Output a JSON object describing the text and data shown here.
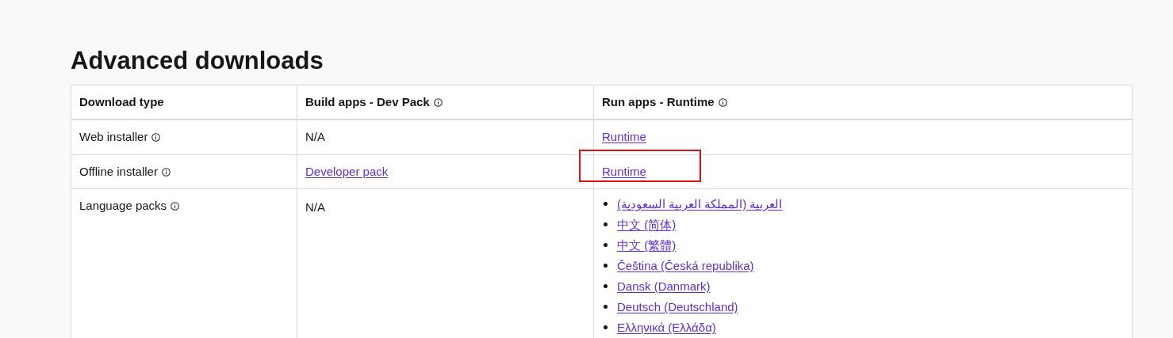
{
  "heading": "Advanced downloads",
  "table": {
    "columns": [
      {
        "label": "Download type",
        "info": false
      },
      {
        "label": "Build apps - Dev Pack",
        "info": true
      },
      {
        "label": "Run apps - Runtime",
        "info": true
      }
    ],
    "rows": [
      {
        "label": "Web installer",
        "info": true,
        "dev_pack": {
          "kind": "text",
          "text": "N/A"
        },
        "runtime": {
          "kind": "link",
          "text": "Runtime",
          "highlighted": false
        }
      },
      {
        "label": "Offline installer",
        "info": true,
        "dev_pack": {
          "kind": "link",
          "text": "Developer pack"
        },
        "runtime": {
          "kind": "link",
          "text": "Runtime",
          "highlighted": true
        }
      },
      {
        "label": "Language packs",
        "info": true,
        "dev_pack": {
          "kind": "text",
          "text": "N/A"
        },
        "runtime": {
          "kind": "list",
          "items": [
            "العربية (المملكة العربية السعودية)",
            "中文 (简体)",
            "中文 (繁體)",
            "Čeština (Česká republika)",
            "Dansk (Danmark)",
            "Deutsch (Deutschland)",
            "Ελληνικά (Ελλάδα)"
          ]
        }
      }
    ]
  }
}
